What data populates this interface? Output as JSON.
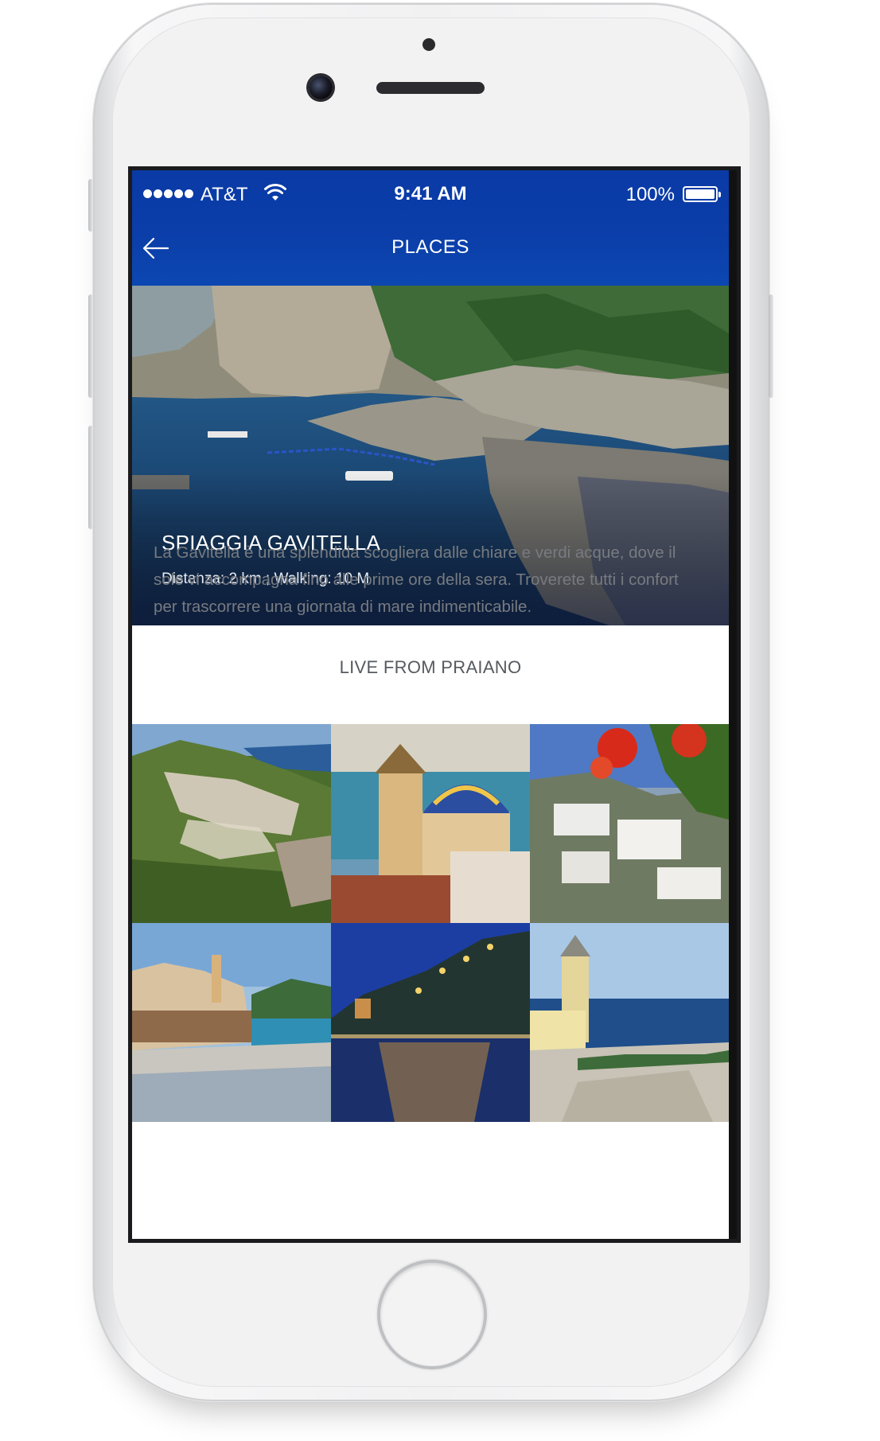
{
  "status_bar": {
    "carrier": "AT&T",
    "time": "9:41 AM",
    "battery": "100%"
  },
  "navbar": {
    "title": "PLACES",
    "back_icon": "arrow-left-icon"
  },
  "hero": {
    "title": "SPIAGGIA GAVITELLA",
    "subtitle": "Distanza: 2 km ; Walking: 10 M"
  },
  "description": "La Gavitella è una splendida scogliera dalle chiare e verdi acque, dove il sole vi accompagna fino alle prime ore della sera. Troverete tutti i confort per trascorrere una giornata di mare indimenticabile.",
  "live_heading": "LIVE FROM PRAIANO",
  "colors": {
    "navbar": "#0b3ea9",
    "text_muted": "#777b80"
  }
}
